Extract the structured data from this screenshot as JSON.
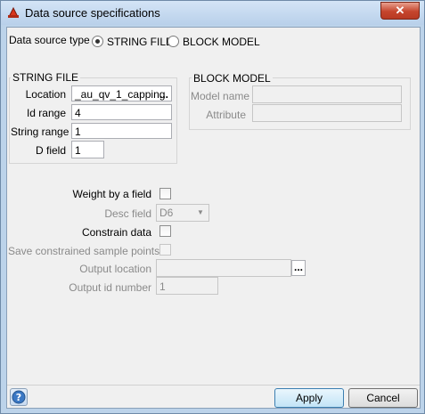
{
  "window": {
    "title": "Data source specifications",
    "close_symbol": "✕"
  },
  "source_type": {
    "label": "Data source type",
    "options": [
      {
        "label": "STRING FILE",
        "selected": true
      },
      {
        "label": "BLOCK MODEL",
        "selected": false
      }
    ]
  },
  "string_file": {
    "title": "STRING FILE",
    "location_label": "Location",
    "location_value": "_au_qv_1_capping",
    "location_browse": "...",
    "id_range_label": "Id range",
    "id_range_value": "4",
    "string_range_label": "String range",
    "string_range_value": "1",
    "d_field_label": "D field",
    "d_field_value": "1"
  },
  "block_model": {
    "title": "BLOCK MODEL",
    "model_name_label": "Model name",
    "model_name_value": "",
    "attribute_label": "Attribute",
    "attribute_value": ""
  },
  "options": {
    "weight_label": "Weight by a field",
    "desc_field_label": "Desc field",
    "desc_field_value": "D6",
    "constrain_label": "Constrain data",
    "save_points_label": "Save constrained sample points?",
    "output_location_label": "Output location",
    "output_location_value": "",
    "output_browse": "...",
    "output_id_label": "Output id number",
    "output_id_value": "1"
  },
  "footer": {
    "apply_label": "Apply",
    "cancel_label": "Cancel"
  },
  "colors": {
    "title_gradient_top": "#d4e4f6",
    "close_red": "#c5452d",
    "primary_button": "#c2e4f6"
  }
}
